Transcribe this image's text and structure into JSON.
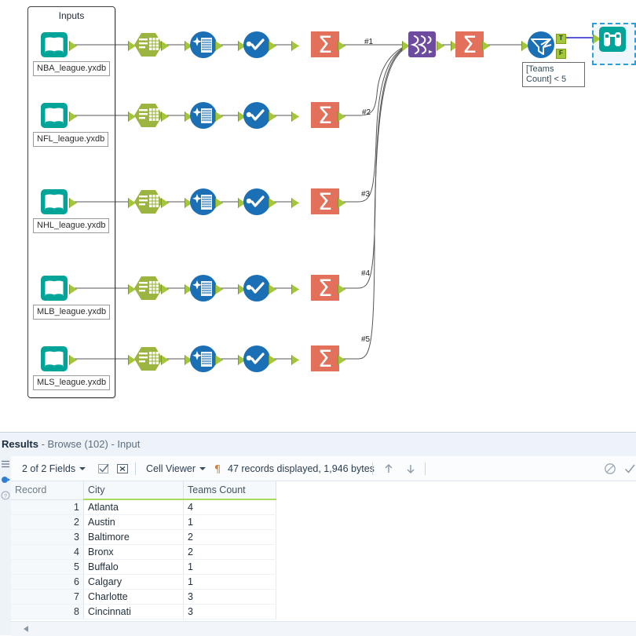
{
  "canvas": {
    "container": {
      "title": "Inputs"
    },
    "inputs": [
      {
        "file": "NBA_league.yxdb",
        "conn_label": "#1"
      },
      {
        "file": "NFL_league.yxdb",
        "conn_label": "#2"
      },
      {
        "file": "NHL_league.yxdb",
        "conn_label": "#3"
      },
      {
        "file": "MLB_league.yxdb",
        "conn_label": "#4"
      },
      {
        "file": "MLS_league.yxdb",
        "conn_label": "#5"
      }
    ],
    "tools": {
      "input": "input-data-tool",
      "select": "select-tool",
      "data_cleansing": "data-cleansing-tool",
      "select_records": "select-records-tool",
      "summarize": "summarize-tool",
      "union": "union-tool",
      "filter": "filter-tool",
      "browse": "browse-tool"
    },
    "filter": {
      "annotation": "[Teams Count] < 5",
      "true_label": "T",
      "false_label": "F"
    },
    "colors": {
      "teal": "#00a499",
      "green": "#a4c63a",
      "olive": "#9cb440",
      "blue": "#1a6fb5",
      "orange": "#e2705a",
      "purple": "#6d4b9e",
      "anchor": "#a4c63a",
      "selection": "#2f9ddb"
    }
  },
  "results": {
    "header": {
      "title": "Results",
      "subtitle": "- Browse (102) - Input"
    },
    "rail": {
      "menu_icon": "hamburger-menu-icon",
      "browse_icon": "browse-anchor-icon",
      "help_icon": "help-icon"
    },
    "toolbar": {
      "fields": "2 of 2 Fields",
      "select_all_icon": "check-box-icon",
      "deselect_all_icon": "x-box-icon",
      "view_mode": "Cell Viewer",
      "pilcrow_icon": "pilcrow-icon",
      "record_info": "47 records displayed, 1,946 bytes",
      "up_icon": "arrow-up-icon",
      "down_icon": "arrow-down-icon",
      "block_icon": "no-entry-icon",
      "check_icon": "check-icon"
    },
    "grid": {
      "columns": [
        "Record",
        "City",
        "Teams Count"
      ],
      "rows": [
        {
          "record": "1",
          "city": "Atlanta",
          "teams": "4"
        },
        {
          "record": "2",
          "city": "Austin",
          "teams": "1"
        },
        {
          "record": "3",
          "city": "Baltimore",
          "teams": "2"
        },
        {
          "record": "4",
          "city": "Bronx",
          "teams": "2"
        },
        {
          "record": "5",
          "city": "Buffalo",
          "teams": "1"
        },
        {
          "record": "6",
          "city": "Calgary",
          "teams": "1"
        },
        {
          "record": "7",
          "city": "Charlotte",
          "teams": "3"
        },
        {
          "record": "8",
          "city": "Cincinnati",
          "teams": "3"
        }
      ]
    },
    "scrollbar": {
      "left_arrow_icon": "scroll-left-arrow-icon"
    }
  }
}
